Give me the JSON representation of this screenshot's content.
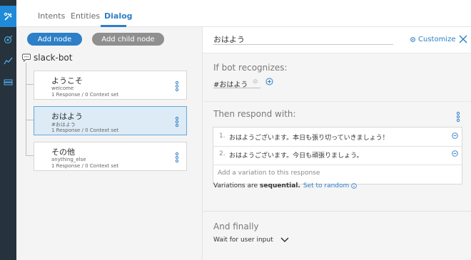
{
  "nav": {
    "tabs": [
      {
        "label": "Intents"
      },
      {
        "label": "Entities"
      },
      {
        "label": "Dialog"
      }
    ]
  },
  "left_panel": {
    "add_node_label": "Add node",
    "add_child_node_label": "Add child node",
    "bot_name": "slack-bot",
    "nodes": [
      {
        "title": "ようこそ",
        "condition": "welcome",
        "meta": "1 Response / 0 Context set"
      },
      {
        "title": "おはよう",
        "condition": "#おはよう",
        "meta": "1 Response / 0 Context set"
      },
      {
        "title": "その他",
        "condition": "anything_else",
        "meta": "1 Response / 0 Context set"
      }
    ]
  },
  "editor": {
    "node_name": "おはよう",
    "customize_label": "Customize",
    "recognizes_title": "If bot recognizes:",
    "condition_value": "#おはよう",
    "respond_title": "Then respond with:",
    "responses": [
      {
        "num": "1.",
        "text": "おはようございます。本日も張り切っていきましょう！"
      },
      {
        "num": "2.",
        "text": "おはようございます。今日も頑張りましょう。"
      }
    ],
    "add_variation_placeholder": "Add a variation to this response",
    "variations_prefix": "Variations are",
    "variations_mode": "sequential.",
    "set_random_label": "Set to random",
    "finally_title": "And finally",
    "finally_action": "Wait for user input"
  },
  "colors": {
    "accent": "#2d7fc7",
    "rail": "#26323c",
    "rail_active": "#1f8ad8"
  }
}
